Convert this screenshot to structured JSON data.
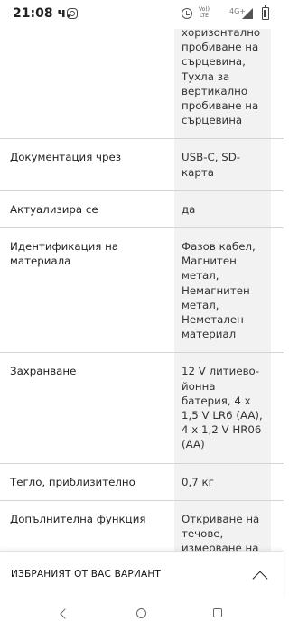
{
  "status_bar": {
    "time": "21:08 ч.",
    "volte_line1": "Vo))",
    "volte_line2": "LTE",
    "network": "4G+"
  },
  "specs": [
    {
      "label": "",
      "value": "хоризонтално пробиване на сърцевина, Тухла за вертикално пробиване на сърцевина"
    },
    {
      "label": "Документация чрез",
      "value": "USB-C, SD-карта"
    },
    {
      "label": "Актуализира се",
      "value": "да"
    },
    {
      "label": "Идентификация на материала",
      "value": "Фазов кабел, Магнитен метал, Немагнитен метал, Неметален материал"
    },
    {
      "label": "Захранване",
      "value": "12 V литиево-йонна батерия, 4 x 1,5 V LR6 (AA), 4 x 1,2 V HR06 (AA)"
    },
    {
      "label": "Тегло, приблизително",
      "value": "0,7 кг"
    },
    {
      "label": "Допълнителна функция",
      "value": "Откриване на течове, измерване на разстояние"
    }
  ],
  "variant_bar": {
    "label": "ИЗБРАНИЯТ ОТ ВАС ВАРИАНТ",
    "icon": "chevron-up-icon"
  },
  "nav": {
    "back_icon": "back-icon",
    "home_icon": "home-icon",
    "recents_icon": "recents-icon"
  }
}
